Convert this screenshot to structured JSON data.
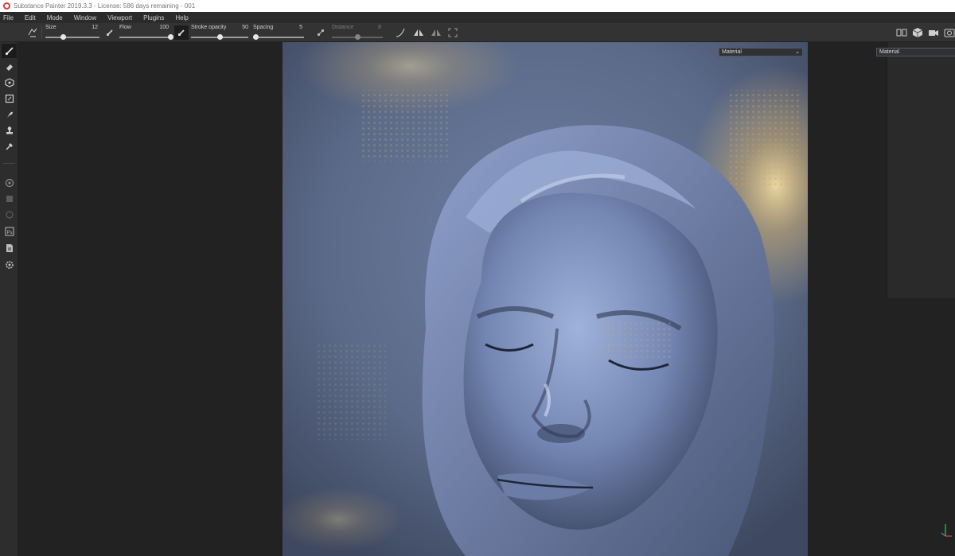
{
  "window": {
    "title": "Substance Painter 2019.3.3 - License: 586 days remaining - 001",
    "accent_color": "#d43a3a"
  },
  "menu": {
    "items": [
      "File",
      "Edit",
      "Mode",
      "Window",
      "Viewport",
      "Plugins",
      "Help"
    ]
  },
  "toolbar": {
    "size": {
      "label": "Size",
      "value": "12",
      "fraction": 0.33
    },
    "flow": {
      "label": "Flow",
      "value": "100",
      "fraction": 1.0
    },
    "stroke_opacity": {
      "label": "Stroke opacity",
      "value": "50",
      "fraction": 0.5
    },
    "spacing": {
      "label": "Spacing",
      "value": "5",
      "fraction": 0.05
    },
    "distance": {
      "label": "Distance",
      "value": "8",
      "fraction": 0.5
    },
    "icons": [
      "lazy-mouse-icon",
      "brush-dynamic-icon",
      "brush-toggle-icon",
      "distance-toggle-icon",
      "curve-icon",
      "symmetry-icon",
      "symmetry-settings-icon",
      "zoom-fit-icon",
      "split-view-icon",
      "environment-icon",
      "camera-icon",
      "screenshot-icon"
    ]
  },
  "left_tools": [
    "paint-brush-icon",
    "eraser-icon",
    "projection-icon",
    "polygon-fill-icon",
    "smudge-icon",
    "clone-stamp-icon",
    "color-picker-icon",
    "bake-icon",
    "viewer-settings-icon",
    "history-icon",
    "photoshop-icon",
    "export-icon",
    "settings-icon"
  ],
  "viewport": {
    "channel_dropdown": "Material",
    "right_view_dropdown": "Material"
  }
}
